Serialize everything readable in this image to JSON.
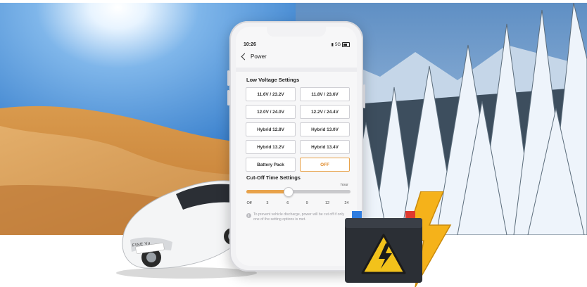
{
  "status": {
    "time": "10:26",
    "network": "5G"
  },
  "nav": {
    "title": "Power"
  },
  "low_voltage": {
    "title": "Low Voltage Settings",
    "options": [
      {
        "label": "11.6V / 23.2V",
        "selected": false
      },
      {
        "label": "11.8V / 23.6V",
        "selected": false
      },
      {
        "label": "12.0V / 24.0V",
        "selected": false
      },
      {
        "label": "12.2V / 24.4V",
        "selected": false
      },
      {
        "label": "Hybrid 12.8V",
        "selected": false
      },
      {
        "label": "Hybrid 13.0V",
        "selected": false
      },
      {
        "label": "Hybrid 13.2V",
        "selected": false
      },
      {
        "label": "Hybrid 13.4V",
        "selected": false
      },
      {
        "label": "Battery Pack",
        "selected": false
      },
      {
        "label": "OFF",
        "selected": true
      }
    ]
  },
  "cutoff": {
    "title": "Cut-Off Time Settings",
    "unit": "hour",
    "ticks": [
      "Off",
      "3",
      "6",
      "9",
      "12",
      "24"
    ],
    "value_fraction": 0.4,
    "note": "To prevent vehicle discharge, power will be cut off if only one of the setting options is met."
  },
  "car": {
    "plate": "FINE Vu"
  },
  "colors": {
    "accent": "#e8a24a",
    "bolt": "#f5b21a",
    "warning": "#f2c21b"
  },
  "icons": [
    "back-chevron-icon",
    "info-icon",
    "lightning-bolt-icon",
    "warning-icon",
    "signal-icon",
    "battery-icon"
  ]
}
